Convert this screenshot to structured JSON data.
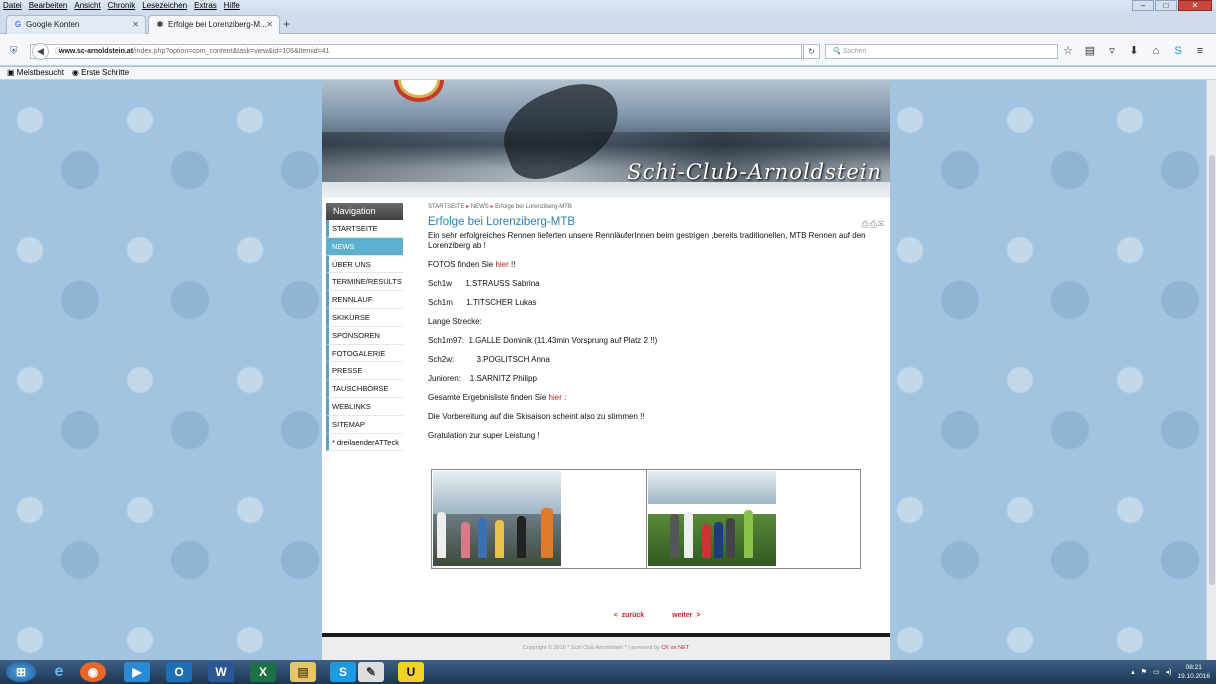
{
  "menubar": [
    "Datei",
    "Bearbeiten",
    "Ansicht",
    "Chronik",
    "Lesezeichen",
    "Extras",
    "Hilfe"
  ],
  "tabs": [
    {
      "label": "Google Konten",
      "icon": "G"
    },
    {
      "label": "Erfolge bei Lorenziberg-M...",
      "icon": "❄"
    }
  ],
  "url": {
    "host": "www.sc-arnoldstein.at",
    "path": "/index.php?option=com_content&task=view&id=105&Itemid=41"
  },
  "search_placeholder": "Suchen",
  "bookmarks": [
    "Meistbesucht",
    "Erste Schritte"
  ],
  "site": {
    "brand": "Schi-Club-Arnoldstein"
  },
  "nav": {
    "header": "Navigation",
    "items": [
      "STARTSEITE",
      "NEWS",
      "ÜBER UNS",
      "TERMINE/RESULTS",
      "RENNLAUF",
      "SKIKURSE",
      "SPONSOREN",
      "FOTOGALERIE",
      "PRESSE",
      "TAUSCHBÖRSE",
      "WEBLINKS",
      "SITEMAP",
      "* dreilaenderATTeck"
    ],
    "active": "NEWS"
  },
  "breadcrumb": {
    "home": "STARTSEITE",
    "section": "NEWS",
    "current": "Erfolge bei Lorenziberg-MTB"
  },
  "article": {
    "title": "Erfolge bei Lorenziberg-MTB",
    "intro": "Ein sehr erfolgreiches Rennen lieferten unsere RennläuferInnen beim gestrigen ,bereits traditionellen, MTB Rennen auf den Lorenziberg ab !",
    "fotos_prefix": "FOTOS finden Sie ",
    "fotos_link": "hier",
    "fotos_suffix": " !!",
    "r1": "Sch1w      1.STRAUSS Sabrina",
    "r2": "Sch1m      1.TITSCHER Lukas",
    "lange": "Lange Strecke:",
    "r3": "Sch1m97:  1.GALLE Dominik (11.43min Vorsprung auf Platz 2 !!)",
    "r4": "Sch2w:          3.POGLITSCH Anna",
    "r5": "Junioren:    1.SARNITZ Philipp",
    "list_prefix": "Gesamte Ergebnisliste finden Sie ",
    "list_link": "hier",
    "list_suffix": " :",
    "line1": "Die Vorbereitung auf die Skisaison scheint also zu stimmen !!",
    "line2": "Gratulation zur super Leistung !"
  },
  "pager": {
    "prev": "< zurück",
    "next": "weiter >"
  },
  "footer": {
    "text": "Copyright © 2016 * Schi Club Arnoldstein * | powered by ",
    "link": "CK on NET"
  },
  "clock": {
    "time": "08:21",
    "date": "19.10.2016"
  }
}
